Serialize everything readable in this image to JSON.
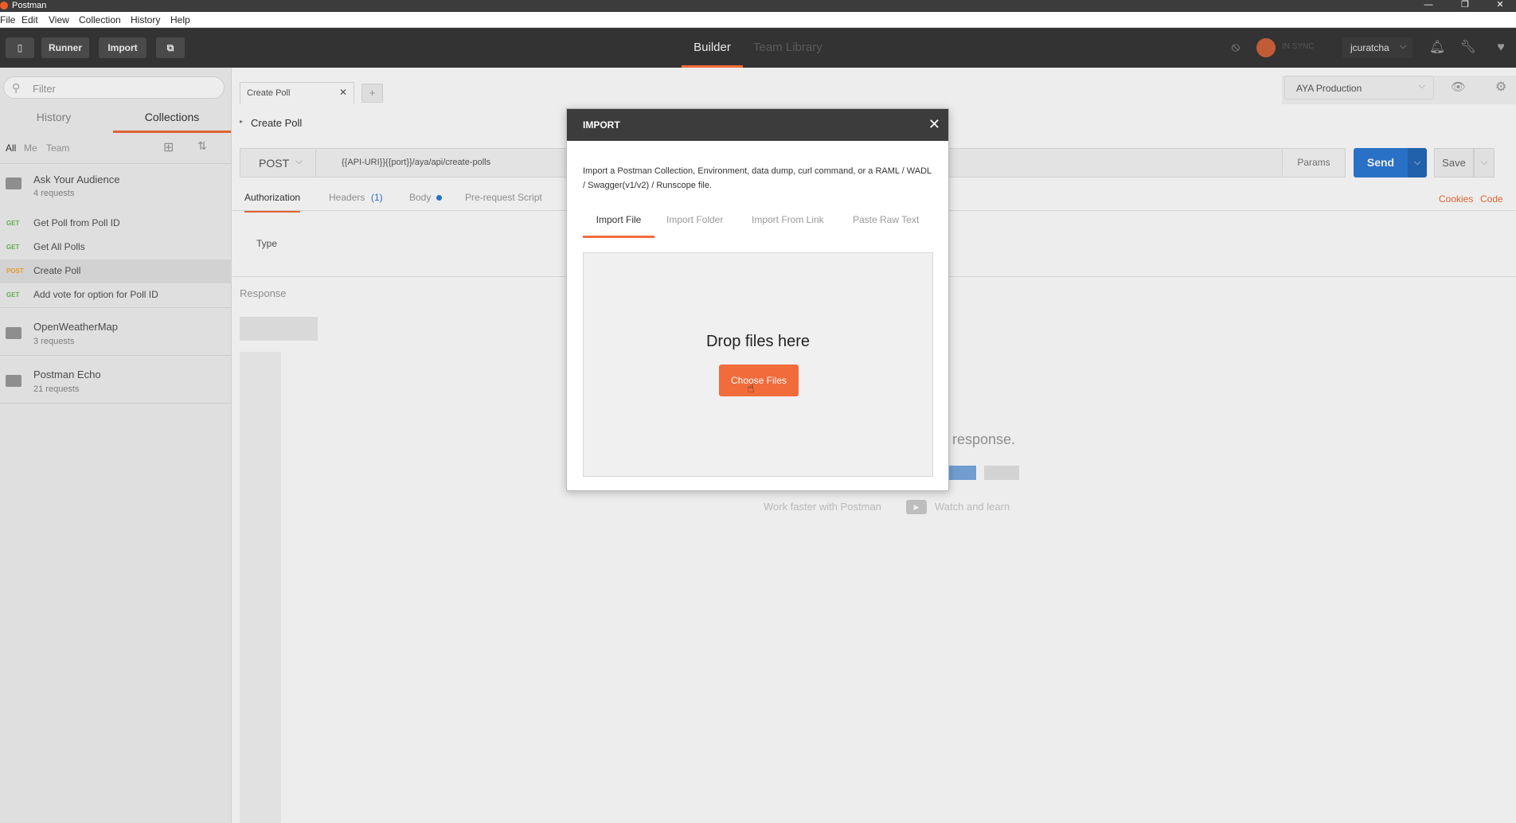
{
  "window": {
    "title": "Postman",
    "controls": [
      "—",
      "❐",
      "✕"
    ]
  },
  "menu": [
    "File",
    "Edit",
    "View",
    "Collection",
    "History",
    "Help"
  ],
  "toolbar": {
    "runner": "Runner",
    "import": "Import",
    "builder": "Builder",
    "team_library": "Team Library",
    "sync_status": "IN SYNC",
    "user": "jcuratcha"
  },
  "sidebar": {
    "filter_placeholder": "Filter",
    "tabs": [
      "History",
      "Collections"
    ],
    "subtabs": [
      "All",
      "Me",
      "Team"
    ],
    "collections": [
      {
        "name": "Ask Your Audience",
        "count": "4 requests"
      },
      {
        "name": "OpenWeatherMap",
        "count": "3 requests"
      },
      {
        "name": "Postman Echo",
        "count": "21 requests"
      }
    ],
    "requests": [
      {
        "method": "GET",
        "name": "Get Poll from Poll ID"
      },
      {
        "method": "GET",
        "name": "Get All Polls"
      },
      {
        "method": "POST",
        "name": "Create Poll"
      },
      {
        "method": "GET",
        "name": "Add vote for option for Poll ID"
      }
    ]
  },
  "request": {
    "tab_title": "Create Poll",
    "add_tab": "+",
    "name": "Create Poll",
    "method": "POST",
    "url": "{{API-URI}}{{port}}/aya/api/create-polls",
    "params": "Params",
    "send": "Send",
    "save": "Save",
    "subtabs": [
      "Authorization",
      "Headers",
      "(1)",
      "Body",
      "Pre-request Script"
    ],
    "cookies": "Cookies",
    "code": "Code",
    "type_label": "Type",
    "response_label": "Response",
    "empty_hint": "response.",
    "work_faster": "Work faster with Postman",
    "watch": "Watch and learn"
  },
  "environment": {
    "selected": "AYA Production"
  },
  "modal": {
    "title": "IMPORT",
    "close": "✕",
    "description": "Import a Postman Collection, Environment, data dump, curl command, or a RAML / WADL / Swagger(v1/v2) / Runscope file.",
    "tabs": [
      "Import File",
      "Import Folder",
      "Import From Link",
      "Paste Raw Text"
    ],
    "drop_text": "Drop files here",
    "choose_button": "Choose Files"
  },
  "colors": {
    "accent": "#f26b3a",
    "send": "#2d7ad6",
    "toolbar": "#333333"
  }
}
